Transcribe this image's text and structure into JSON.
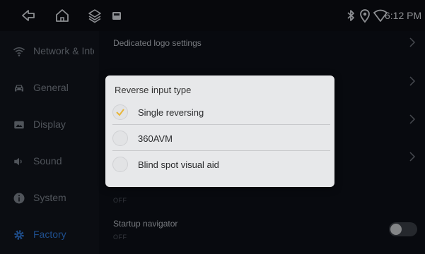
{
  "status_bar": {
    "time": "6:12 PM",
    "icons": [
      "back-icon",
      "home-icon",
      "layers-icon",
      "notification-square-icon",
      "bluetooth-icon",
      "location-icon",
      "wifi-icon"
    ]
  },
  "sidebar": {
    "items": [
      {
        "label": "Network & Internet",
        "icon": "wifi-icon"
      },
      {
        "label": "General",
        "icon": "car-icon"
      },
      {
        "label": "Display",
        "icon": "display-icon"
      },
      {
        "label": "Sound",
        "icon": "speaker-icon"
      },
      {
        "label": "System",
        "icon": "info-icon"
      },
      {
        "label": "Factory",
        "icon": "gear-icon",
        "active": true
      }
    ]
  },
  "content": {
    "dedicated_logo": {
      "title": "Dedicated logo settings"
    },
    "partial_row": {
      "title": "...",
      "value": "OFF"
    },
    "startup_navigator": {
      "title": "Startup navigator",
      "value": "OFF",
      "toggle_on": false
    }
  },
  "dialog": {
    "title": "Reverse input type",
    "options": [
      {
        "label": "Single reversing",
        "selected": true
      },
      {
        "label": "360AVM",
        "selected": false
      },
      {
        "label": "Blind spot visual aid",
        "selected": false
      }
    ]
  },
  "colors": {
    "accent": "#2f77d6",
    "check": "#e8b63a",
    "dialog_bg": "#e7e8ea",
    "screen_bg": "#0d1017"
  }
}
